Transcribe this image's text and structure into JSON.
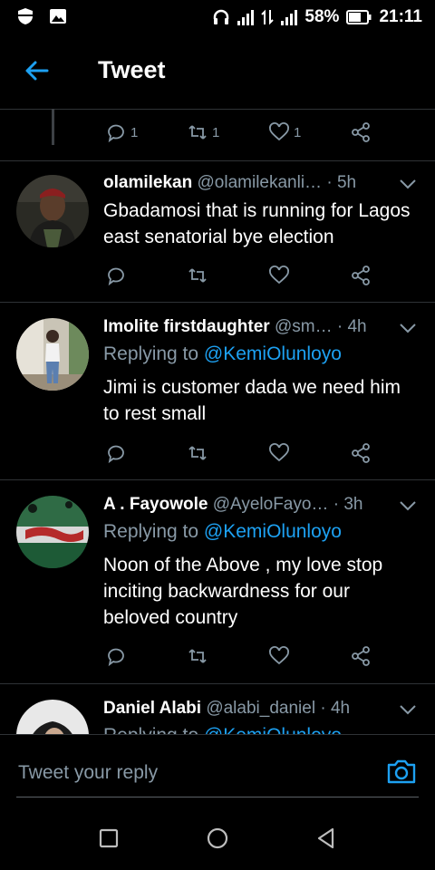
{
  "status_bar": {
    "battery": "58%",
    "time": "21:11"
  },
  "header": {
    "title": "Tweet"
  },
  "parent_actions": {
    "reply_count": "1",
    "retweet_count": "1",
    "like_count": "1"
  },
  "tweets": [
    {
      "name": "olamilekan",
      "handle": "@olamilekanli…",
      "separator": "·",
      "age": "5h",
      "replying_to": "",
      "body": "Gbadamosi that is running for Lagos east senatorial bye election"
    },
    {
      "name": "Imolite firstdaughter",
      "handle": "@sm…",
      "separator": "·",
      "age": "4h",
      "replying_prefix": "Replying to ",
      "replying_to": "@KemiOlunloyo",
      "body": "Jimi is customer dada we need him to rest small"
    },
    {
      "name": "A . Fayowole",
      "handle": "@AyeloFayo…",
      "separator": "·",
      "age": "3h",
      "replying_prefix": "Replying to ",
      "replying_to": "@KemiOlunloyo",
      "body": "Noon of the Above , my love stop inciting backwardness for our beloved country"
    },
    {
      "name": "Daniel Alabi",
      "handle": "@alabi_daniel",
      "separator": "·",
      "age": "4h",
      "replying_prefix": "Replying to ",
      "replying_to": "@KemiOlunloyo",
      "body": ""
    }
  ],
  "composer": {
    "placeholder": "Tweet your reply"
  },
  "icons": {
    "accent": "#1da1f2",
    "muted": "#8899a6",
    "reply": "reply-icon",
    "retweet": "retweet-icon",
    "like": "heart-icon",
    "share": "share-icon",
    "camera": "camera-icon",
    "back": "back-arrow-icon"
  }
}
